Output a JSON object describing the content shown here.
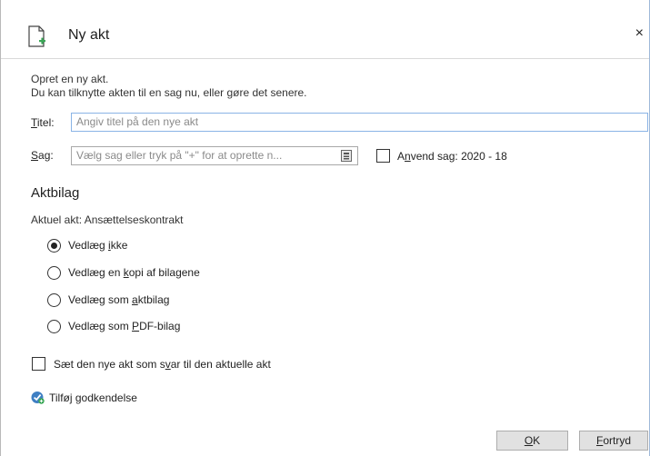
{
  "dialog": {
    "title": "Ny akt",
    "close_glyph": "×",
    "icon": "new-document-icon"
  },
  "intro": {
    "line1": "Opret en ny akt.",
    "line2": "Du kan tilknytte akten til en sag nu, eller gøre det senere."
  },
  "form": {
    "title_label_accel": "T",
    "title_label_rest": "itel:",
    "title_placeholder": "Angiv titel på den nye akt",
    "case_label_accel": "S",
    "case_label_rest": "ag:",
    "case_placeholder": "Vælg sag eller tryk på \"+\" for at oprette n...",
    "apply_case_prefix": "A",
    "apply_case_accel": "n",
    "apply_case_rest": "vend sag: 2020 - 18"
  },
  "attachments": {
    "heading": "Aktbilag",
    "current": "Aktuel akt: Ansættelseskontrakt",
    "options": [
      {
        "pre": "Vedlæg ",
        "accel": "i",
        "post": "kke",
        "selected": true
      },
      {
        "pre": "Vedlæg en ",
        "accel": "k",
        "post": "opi af bilagene",
        "selected": false
      },
      {
        "pre": "Vedlæg som ",
        "accel": "a",
        "post": "ktbilag",
        "selected": false
      },
      {
        "pre": "Vedlæg som ",
        "accel": "P",
        "post": "DF-bilag",
        "selected": false
      }
    ]
  },
  "reply": {
    "pre": "Sæt den nye akt som s",
    "accel": "v",
    "post": "ar til den aktuelle akt"
  },
  "approval": {
    "label": "Tilføj godkendelse",
    "icon": "add-approval-icon"
  },
  "buttons": {
    "ok_accel": "O",
    "ok_rest": "K",
    "cancel_accel": "F",
    "cancel_rest": "ortryd"
  },
  "colors": {
    "accent_border": "#8ab4e6",
    "button_bg": "#e1e1e1",
    "icon_green": "#3aa757",
    "icon_blue": "#3f7fc3"
  }
}
